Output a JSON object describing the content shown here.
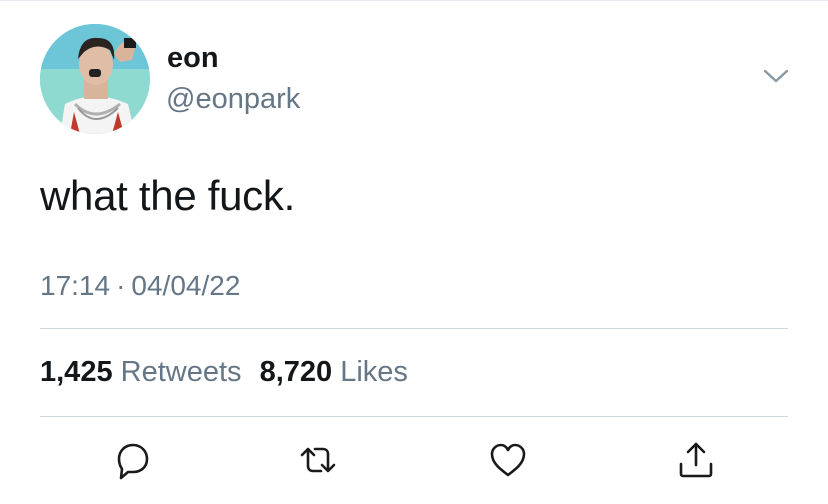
{
  "tweet": {
    "author": {
      "display_name": "eon",
      "handle": "@eonpark"
    },
    "text": "what the fuck.",
    "time": "17:14",
    "separator": "·",
    "date": "04/04/22",
    "stats": {
      "retweets_count": "1,425",
      "retweets_label": "Retweets",
      "likes_count": "8,720",
      "likes_label": "Likes"
    },
    "actions": {
      "reply_icon": "reply-icon",
      "retweet_icon": "retweet-icon",
      "like_icon": "heart-icon",
      "share_icon": "share-icon"
    }
  },
  "colors": {
    "primary_text": "#14171a",
    "secondary_text": "#657786",
    "divider": "#cfd9de"
  }
}
